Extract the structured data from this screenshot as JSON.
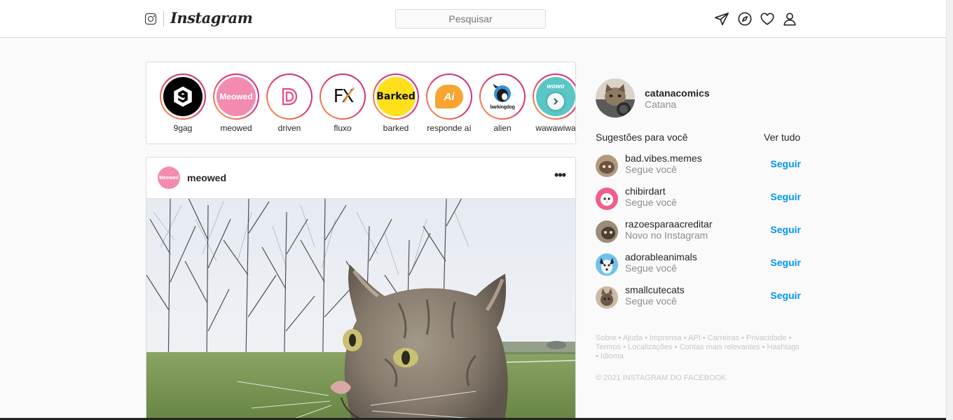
{
  "header": {
    "logo_text": "Instagram",
    "search_placeholder": "Pesquisar",
    "icons": [
      "direct-icon",
      "explore-icon",
      "heart-icon",
      "profile-icon"
    ]
  },
  "stories": [
    {
      "name": "9gag",
      "badge": "9"
    },
    {
      "name": "meowed",
      "badge": "Meowed"
    },
    {
      "name": "driven",
      "badge": "D"
    },
    {
      "name": "fluxo",
      "badge": "FX"
    },
    {
      "name": "barked",
      "badge": "Barked"
    },
    {
      "name": "responde aí",
      "badge": "Ai"
    },
    {
      "name": "alien",
      "badge": "barkingdog"
    },
    {
      "name": "wawawiwa",
      "badge": "wowo"
    }
  ],
  "post": {
    "username": "meowed",
    "avatar_text": "Meowed",
    "more_label": "•••"
  },
  "profile": {
    "username": "catanacomics",
    "name": "Catana"
  },
  "suggestions": {
    "title": "Sugestões para você",
    "see_all": "Ver tudo",
    "follow_label": "Seguir",
    "items": [
      {
        "username": "bad.vibes.memes",
        "note": "Segue você"
      },
      {
        "username": "chibirdart",
        "note": "Segue você"
      },
      {
        "username": "razoesparaacreditar",
        "note": "Novo no Instagram"
      },
      {
        "username": "adorableanimals",
        "note": "Segue você"
      },
      {
        "username": "smallcutecats",
        "note": "Segue você"
      }
    ]
  },
  "footer": {
    "links": "Sobre • Ajuda • Imprensa • API • Carreiras • Privacidade • Termos • Localizações • Contas mais relevantes • Hashtags • Idioma",
    "copyright": "© 2021 INSTAGRAM DO FACEBOOK"
  },
  "colors": {
    "accent": "#0095f6",
    "ring_start": "#f9a545",
    "ring_end": "#c13584",
    "muted": "#8e8e8e",
    "border": "#dbdbdb"
  }
}
